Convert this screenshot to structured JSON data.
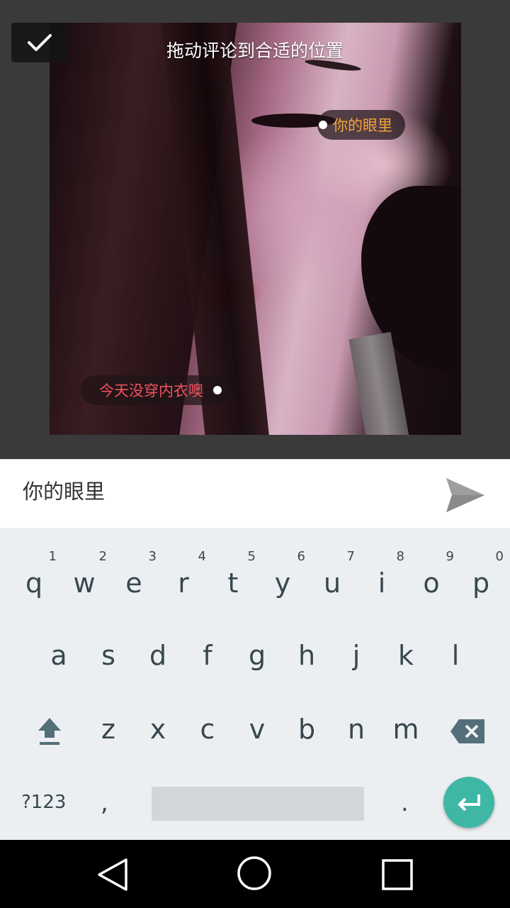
{
  "header": {
    "hint": "拖动评论到合适的位置"
  },
  "tags": [
    {
      "text": "你的眼里",
      "color": "#f4a43a"
    },
    {
      "text": "今天没穿内衣噢",
      "color": "#f0525d"
    }
  ],
  "input": {
    "value": "你的眼里"
  },
  "keyboard": {
    "row1": [
      {
        "letter": "q",
        "num": "1"
      },
      {
        "letter": "w",
        "num": "2"
      },
      {
        "letter": "e",
        "num": "3"
      },
      {
        "letter": "r",
        "num": "4"
      },
      {
        "letter": "t",
        "num": "5"
      },
      {
        "letter": "y",
        "num": "6"
      },
      {
        "letter": "u",
        "num": "7"
      },
      {
        "letter": "i",
        "num": "8"
      },
      {
        "letter": "o",
        "num": "9"
      },
      {
        "letter": "p",
        "num": "0"
      }
    ],
    "row2": [
      "a",
      "s",
      "d",
      "f",
      "g",
      "h",
      "j",
      "k",
      "l"
    ],
    "row3": [
      "z",
      "x",
      "c",
      "v",
      "b",
      "n",
      "m"
    ],
    "symbols_label": "?123",
    "comma": ",",
    "period": "."
  },
  "colors": {
    "enter_key": "#3fb7a5",
    "tag_orange": "#f4a43a",
    "tag_red": "#f0525d"
  },
  "icons": {
    "done": "check-icon",
    "send": "send-icon",
    "shift": "shift-icon",
    "backspace": "backspace-icon",
    "enter": "enter-icon",
    "nav_back": "back-triangle-icon",
    "nav_home": "home-circle-icon",
    "nav_recent": "recent-square-icon"
  }
}
